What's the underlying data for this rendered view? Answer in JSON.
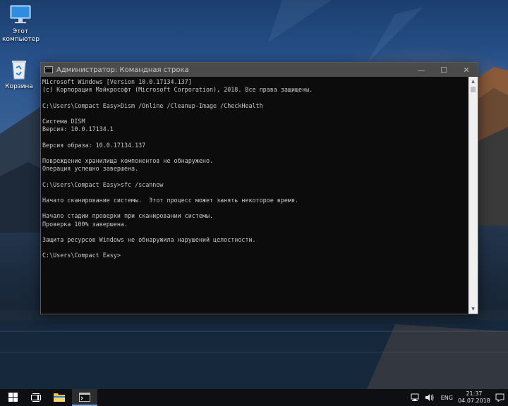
{
  "desktop": {
    "icons": [
      {
        "label_line1": "Этот",
        "label_line2": "компьютер",
        "icon": "this-pc-icon"
      },
      {
        "label_line1": "Корзина",
        "label_line2": "",
        "icon": "recycle-bin-icon"
      }
    ]
  },
  "window": {
    "title": "Администратор: Командная строка",
    "icon": "cmd-icon",
    "buttons": {
      "minimize": "—",
      "maximize": "☐",
      "close": "✕"
    },
    "lines": [
      "Microsoft Windows [Version 10.0.17134.137]",
      "(с) Корпорация Майкрософт (Microsoft Corporation), 2018. Все права защищены.",
      "",
      "C:\\Users\\Compact Easy>Dism /Online /Cleanup-Image /CheckHealth",
      "",
      "Cистема DISM",
      "Версия: 10.0.17134.1",
      "",
      "Версия образа: 10.0.17134.137",
      "",
      "Повреждение хранилища компонентов не обнаружено.",
      "Операция успешно завершена.",
      "",
      "C:\\Users\\Compact Easy>sfc /scannow",
      "",
      "Начато сканирование системы.  Этот процесс может занять некоторое время.",
      "",
      "Начало стадии проверки при сканировании системы.",
      "Проверка 100% завершена.",
      "",
      "Защита ресурсов Windows не обнаружила нарушений целостности.",
      "",
      "C:\\Users\\Compact Easy>"
    ]
  },
  "taskbar": {
    "start_icon": "windows-start-icon",
    "task_view_icon": "task-view-icon",
    "apps": [
      {
        "name": "file-explorer",
        "icon": "folder-icon",
        "active": false
      },
      {
        "name": "command-prompt",
        "icon": "cmd-icon",
        "active": true
      }
    ],
    "tray": {
      "network_icon": "network-icon",
      "volume_icon": "volume-icon",
      "language": "ENG",
      "time": "21:37",
      "date": "04.07.2018",
      "notifications_icon": "notifications-icon"
    }
  }
}
